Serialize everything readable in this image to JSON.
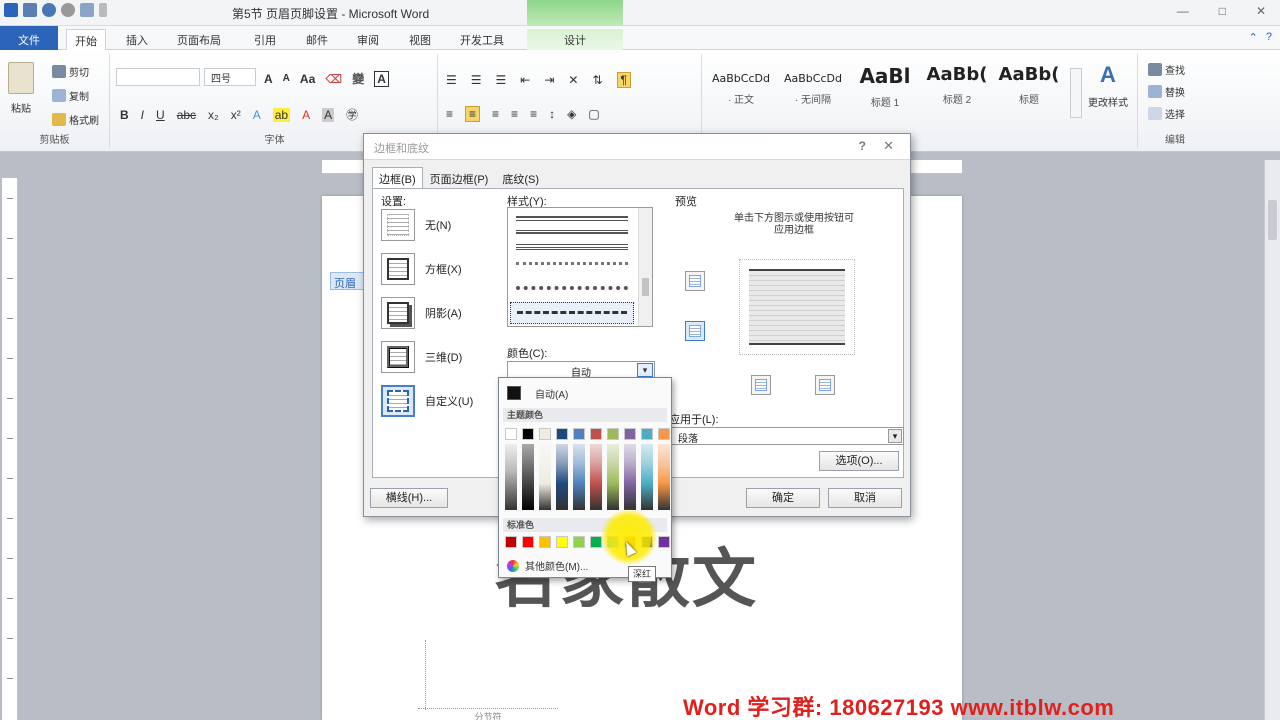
{
  "window": {
    "title": "第5节 页眉页脚设置 - Microsoft Word",
    "contextual_tab_title": "",
    "window_buttons": [
      "—",
      "□",
      "✕"
    ]
  },
  "tabs": [
    {
      "label": "文件"
    },
    {
      "label": "开始"
    },
    {
      "label": "插入"
    },
    {
      "label": "页面布局"
    },
    {
      "label": "引用"
    },
    {
      "label": "邮件"
    },
    {
      "label": "审阅"
    },
    {
      "label": "视图"
    },
    {
      "label": "开发工具"
    },
    {
      "label": "设计"
    }
  ],
  "ribbon": {
    "clipboard": {
      "paste": "粘贴",
      "cut": "剪切",
      "copy": "复制",
      "format_painter": "格式刷",
      "group_label": "剪贴板"
    },
    "font": {
      "font_size": "四号",
      "group_label": "字体"
    },
    "styles": [
      {
        "sample": "AaBbCcDd",
        "name": "· 正文"
      },
      {
        "sample": "AaBbCcDd",
        "name": "· 无间隔"
      },
      {
        "sample": "AaBl",
        "name": "标题 1"
      },
      {
        "sample": "AaBb(",
        "name": "标题 2"
      },
      {
        "sample": "AaBb(",
        "name": "标题"
      }
    ],
    "change_styles": "更改样式",
    "editing": {
      "find": "查找",
      "replace": "替换",
      "select": "选择",
      "group_label": "编辑"
    }
  },
  "document": {
    "page_tag": "页眉",
    "title_text": "名家散文",
    "section_break": "分节符"
  },
  "dialog": {
    "title": "边框和底纹",
    "tabs": [
      "边框(B)",
      "页面边框(P)",
      "底纹(S)"
    ],
    "settings_label": "设置:",
    "settings": [
      {
        "label": "无(N)",
        "kind": "none"
      },
      {
        "label": "方框(X)",
        "kind": "box"
      },
      {
        "label": "阴影(A)",
        "kind": "shadow"
      },
      {
        "label": "三维(D)",
        "kind": "3d"
      },
      {
        "label": "自定义(U)",
        "kind": "custom"
      }
    ],
    "style_label": "样式(Y):",
    "color_label": "颜色(C):",
    "color_value": "自动",
    "preview_label": "预览",
    "preview_hint_line1": "单击下方图示或使用按钮可",
    "preview_hint_line2": "应用边框",
    "apply_label": "应用于(L):",
    "apply_value": "段落",
    "options_button": "选项(O)...",
    "hline_button": "横线(H)...",
    "ok_button": "确定",
    "cancel_button": "取消"
  },
  "color_palette": {
    "automatic_label": "自动(A)",
    "theme_label": "主题颜色",
    "standard_label": "标准色",
    "more_colors_label": "其他颜色(M)...",
    "tooltip": "深红",
    "theme_colors": [
      "#ffffff",
      "#000000",
      "#eeece1",
      "#1f497d",
      "#4f81bd",
      "#c0504d",
      "#9bbb59",
      "#8064a2",
      "#4bacc6",
      "#f79646"
    ],
    "standard_colors": [
      "#c00000",
      "#ff0000",
      "#ffc000",
      "#ffff00",
      "#92d050",
      "#00b050",
      "#00b0f0",
      "#c00000",
      "#002060",
      "#7030a0"
    ]
  },
  "watermark": "Word 学习群: 180627193   www.itblw.com"
}
